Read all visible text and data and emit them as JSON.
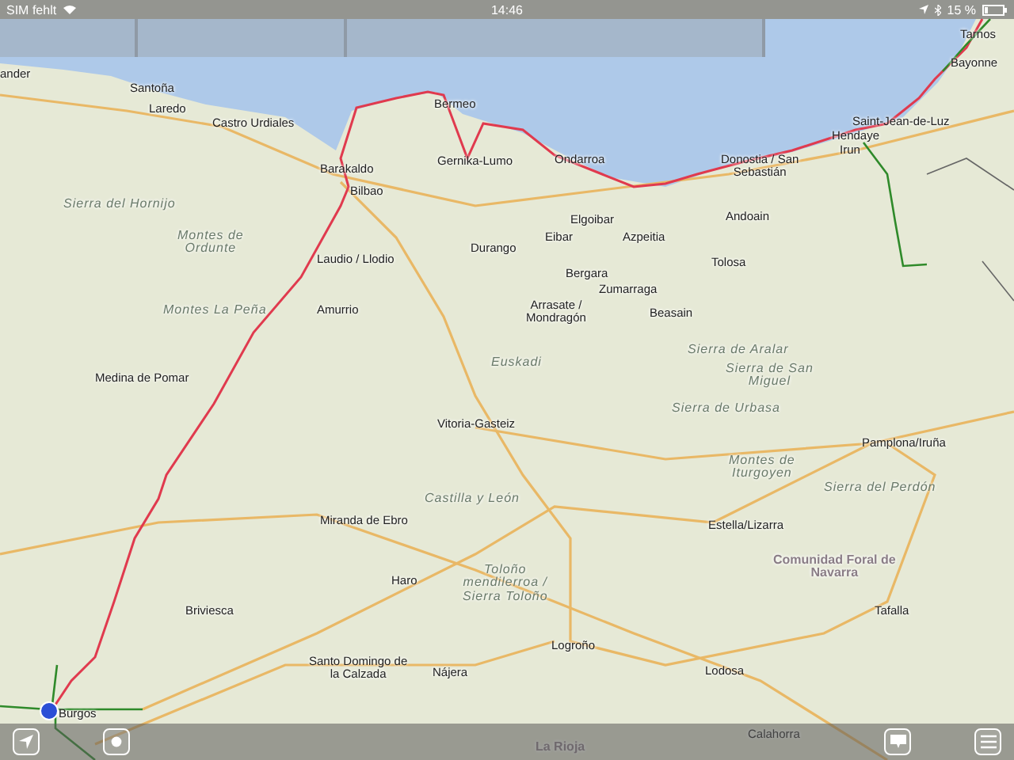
{
  "status_bar": {
    "carrier": "SIM fehlt",
    "time": "14:46",
    "battery": "15 %"
  },
  "map": {
    "labels": [
      {
        "kind": "city",
        "lines": [
          "Tarnos"
        ]
      },
      {
        "kind": "city",
        "lines": [
          "Bayonne"
        ]
      },
      {
        "kind": "city",
        "lines": [
          "ander"
        ]
      },
      {
        "kind": "city",
        "lines": [
          "Santoña"
        ]
      },
      {
        "kind": "city",
        "lines": [
          "Bermeo"
        ]
      },
      {
        "kind": "city",
        "lines": [
          "Laredo"
        ]
      },
      {
        "kind": "city",
        "lines": [
          "Castro Urdiales"
        ]
      },
      {
        "kind": "city",
        "lines": [
          "Saint-Jean-de-Luz"
        ]
      },
      {
        "kind": "city",
        "lines": [
          "Hendaye"
        ]
      },
      {
        "kind": "city",
        "lines": [
          "Irun"
        ]
      },
      {
        "kind": "city",
        "lines": [
          "Barakaldo"
        ]
      },
      {
        "kind": "city",
        "lines": [
          "Gernika-Lumo"
        ]
      },
      {
        "kind": "city",
        "lines": [
          "Ondarroa"
        ]
      },
      {
        "kind": "city",
        "lines": [
          "Donostia / San",
          "Sebastián"
        ]
      },
      {
        "kind": "city",
        "lines": [
          "Bilbao"
        ]
      },
      {
        "kind": "region",
        "lines": [
          "Sierra del Hornijo"
        ]
      },
      {
        "kind": "city",
        "lines": [
          "Elgoibar"
        ]
      },
      {
        "kind": "city",
        "lines": [
          "Andoain"
        ]
      },
      {
        "kind": "region",
        "lines": [
          "Montes de",
          "Ordunte"
        ]
      },
      {
        "kind": "city",
        "lines": [
          "Eibar"
        ]
      },
      {
        "kind": "city",
        "lines": [
          "Azpeitia"
        ]
      },
      {
        "kind": "city",
        "lines": [
          "Durango"
        ]
      },
      {
        "kind": "city",
        "lines": [
          "Laudio / Llodio"
        ]
      },
      {
        "kind": "city",
        "lines": [
          "Tolosa"
        ]
      },
      {
        "kind": "city",
        "lines": [
          "Bergara"
        ]
      },
      {
        "kind": "city",
        "lines": [
          "Zumarraga"
        ]
      },
      {
        "kind": "region",
        "lines": [
          "Montes La Peña"
        ]
      },
      {
        "kind": "city",
        "lines": [
          "Amurrio"
        ]
      },
      {
        "kind": "city",
        "lines": [
          "Arrasate /",
          "Mondragón"
        ]
      },
      {
        "kind": "city",
        "lines": [
          "Beasain"
        ]
      },
      {
        "kind": "region",
        "lines": [
          "Euskadi"
        ]
      },
      {
        "kind": "region",
        "lines": [
          "Sierra de Aralar"
        ]
      },
      {
        "kind": "city",
        "lines": [
          "Medina de Pomar"
        ]
      },
      {
        "kind": "region",
        "lines": [
          "Sierra de San",
          "Miguel"
        ]
      },
      {
        "kind": "region",
        "lines": [
          "Sierra de Urbasa"
        ]
      },
      {
        "kind": "city",
        "lines": [
          "Vitoria-Gasteiz"
        ]
      },
      {
        "kind": "city",
        "lines": [
          "Pamplona/Iruña"
        ]
      },
      {
        "kind": "region",
        "lines": [
          "Montes de",
          "Iturgoyen"
        ]
      },
      {
        "kind": "region",
        "lines": [
          "Sierra del Perdón"
        ]
      },
      {
        "kind": "region",
        "lines": [
          "Castilla y León"
        ]
      },
      {
        "kind": "city",
        "lines": [
          "Miranda de Ebro"
        ]
      },
      {
        "kind": "city",
        "lines": [
          "Estella/Lizarra"
        ]
      },
      {
        "kind": "city",
        "lines": [
          "Haro"
        ]
      },
      {
        "kind": "region",
        "lines": [
          "Toloño",
          "mendilerroa /",
          "Sierra Toloño"
        ]
      },
      {
        "kind": "state",
        "lines": [
          "Comunidad Foral de",
          "Navarra"
        ]
      },
      {
        "kind": "city",
        "lines": [
          "Briviesca"
        ]
      },
      {
        "kind": "city",
        "lines": [
          "Tafalla"
        ]
      },
      {
        "kind": "city",
        "lines": [
          "Logroño"
        ]
      },
      {
        "kind": "city",
        "lines": [
          "Santo Domingo de",
          "la Calzada"
        ]
      },
      {
        "kind": "city",
        "lines": [
          "Nájera"
        ]
      },
      {
        "kind": "city",
        "lines": [
          "Lodosa"
        ]
      },
      {
        "kind": "city",
        "lines": [
          "Burgos"
        ]
      },
      {
        "kind": "state",
        "lines": [
          "La Rioja"
        ]
      },
      {
        "kind": "city",
        "lines": [
          "Calahorra"
        ]
      }
    ]
  }
}
